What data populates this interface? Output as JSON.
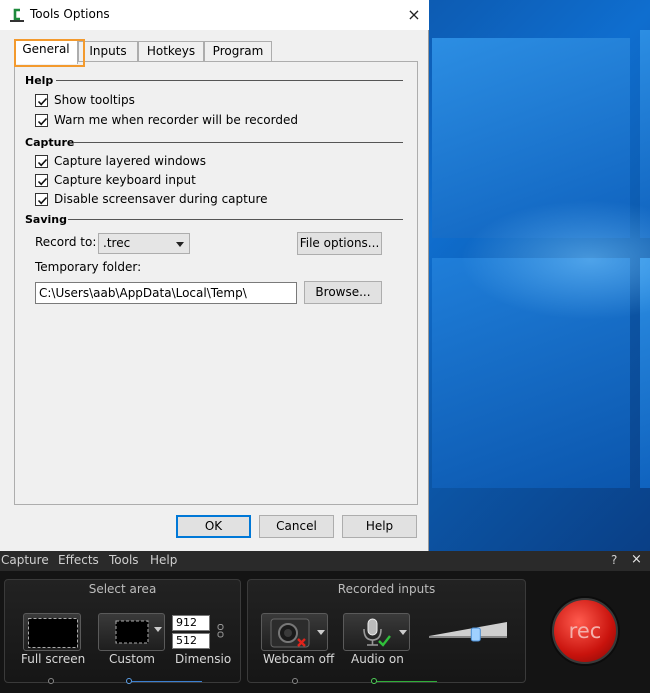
{
  "dialog": {
    "title": "Tools Options",
    "close_glyph": "×",
    "tabs": [
      {
        "label": "General",
        "active": true
      },
      {
        "label": "Inputs",
        "active": false
      },
      {
        "label": "Hotkeys",
        "active": false
      },
      {
        "label": "Program",
        "active": false
      }
    ],
    "help": {
      "heading": "Help",
      "options": [
        {
          "label": "Show tooltips",
          "checked": true
        },
        {
          "label": "Warn me when recorder will be recorded",
          "checked": true
        }
      ]
    },
    "capture": {
      "heading": "Capture",
      "options": [
        {
          "label": "Capture layered windows",
          "checked": true
        },
        {
          "label": "Capture keyboard input",
          "checked": true
        },
        {
          "label": "Disable screensaver during capture",
          "checked": true
        }
      ]
    },
    "saving": {
      "heading": "Saving",
      "record_to_label": "Record to:",
      "record_to_value": ".trec",
      "file_options_label": "File options...",
      "temp_folder_label": "Temporary folder:",
      "temp_folder_value": "C:\\Users\\aab\\AppData\\Local\\Temp\\",
      "browse_label": "Browse..."
    },
    "buttons": {
      "ok": "OK",
      "cancel": "Cancel",
      "help": "Help"
    }
  },
  "recorder": {
    "menu": [
      "Capture",
      "Effects",
      "Tools",
      "Help"
    ],
    "help_glyph": "?",
    "close_glyph": "×",
    "select_area": {
      "title": "Select area",
      "full_screen": "Full screen",
      "custom": "Custom",
      "width": "912",
      "height": "512",
      "dimensions": "Dimensio"
    },
    "recorded_inputs": {
      "title": "Recorded inputs",
      "webcam": "Webcam off",
      "audio": "Audio on",
      "volume_level": 0.6
    },
    "rec_label": "rec"
  },
  "colors": {
    "accent_orange": "#f39a2e",
    "default_button_border": "#0078d7",
    "rec_red": "#c9130d"
  }
}
